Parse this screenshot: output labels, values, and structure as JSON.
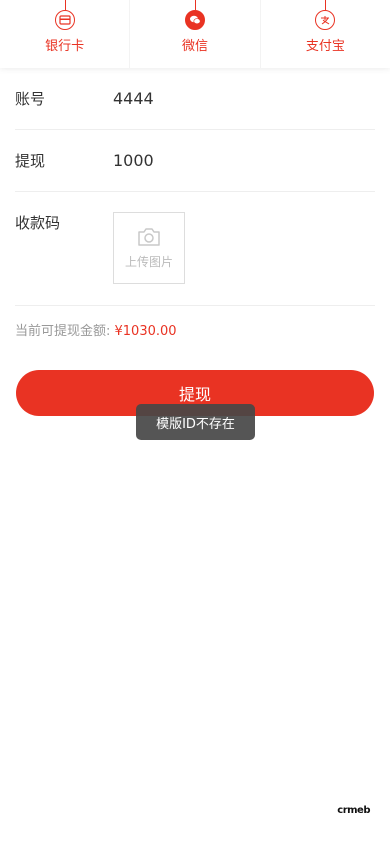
{
  "tabs": [
    {
      "label": "银行卡",
      "icon": "bank-card-icon"
    },
    {
      "label": "微信",
      "icon": "wechat-icon"
    },
    {
      "label": "支付宝",
      "icon": "alipay-icon"
    }
  ],
  "form": {
    "account_label": "账号",
    "account_value": "4444",
    "amount_label": "提现",
    "amount_value": "1000",
    "qrcode_label": "收款码",
    "upload_text": "上传图片"
  },
  "balance": {
    "label": "当前可提现金额: ",
    "amount": "¥1030.00"
  },
  "submit_label": "提现",
  "toast_text": "模版ID不存在",
  "brand_text": "crmeb",
  "colors": {
    "accent": "#e93323",
    "toast_bg": "#464646"
  }
}
